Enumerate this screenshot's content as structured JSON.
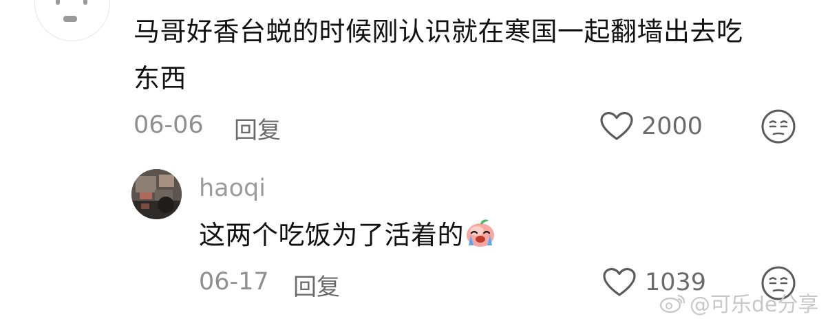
{
  "comments": [
    {
      "text_line1": "马哥好香台蜕的时候刚认识就在寒国一起翻墙出去吃",
      "text_line2": "东西",
      "date": "06-06",
      "reply_label": "回复",
      "likes": "2000",
      "icons": [
        "heart-outline-icon",
        "unamused-face-icon"
      ]
    },
    {
      "username": "haoqi",
      "text": "这两个吃饭为了活着的",
      "emoji": "crying-peach-emoji",
      "date": "06-17",
      "reply_label": "回复",
      "likes": "1039",
      "icons": [
        "heart-outline-icon",
        "unamused-face-icon"
      ]
    }
  ],
  "watermark": "@可乐de分享",
  "colors": {
    "text": "#111111",
    "meta": "#8f8f8f",
    "icon": "#5a5a5a",
    "watermark": "#c8c8c8"
  }
}
